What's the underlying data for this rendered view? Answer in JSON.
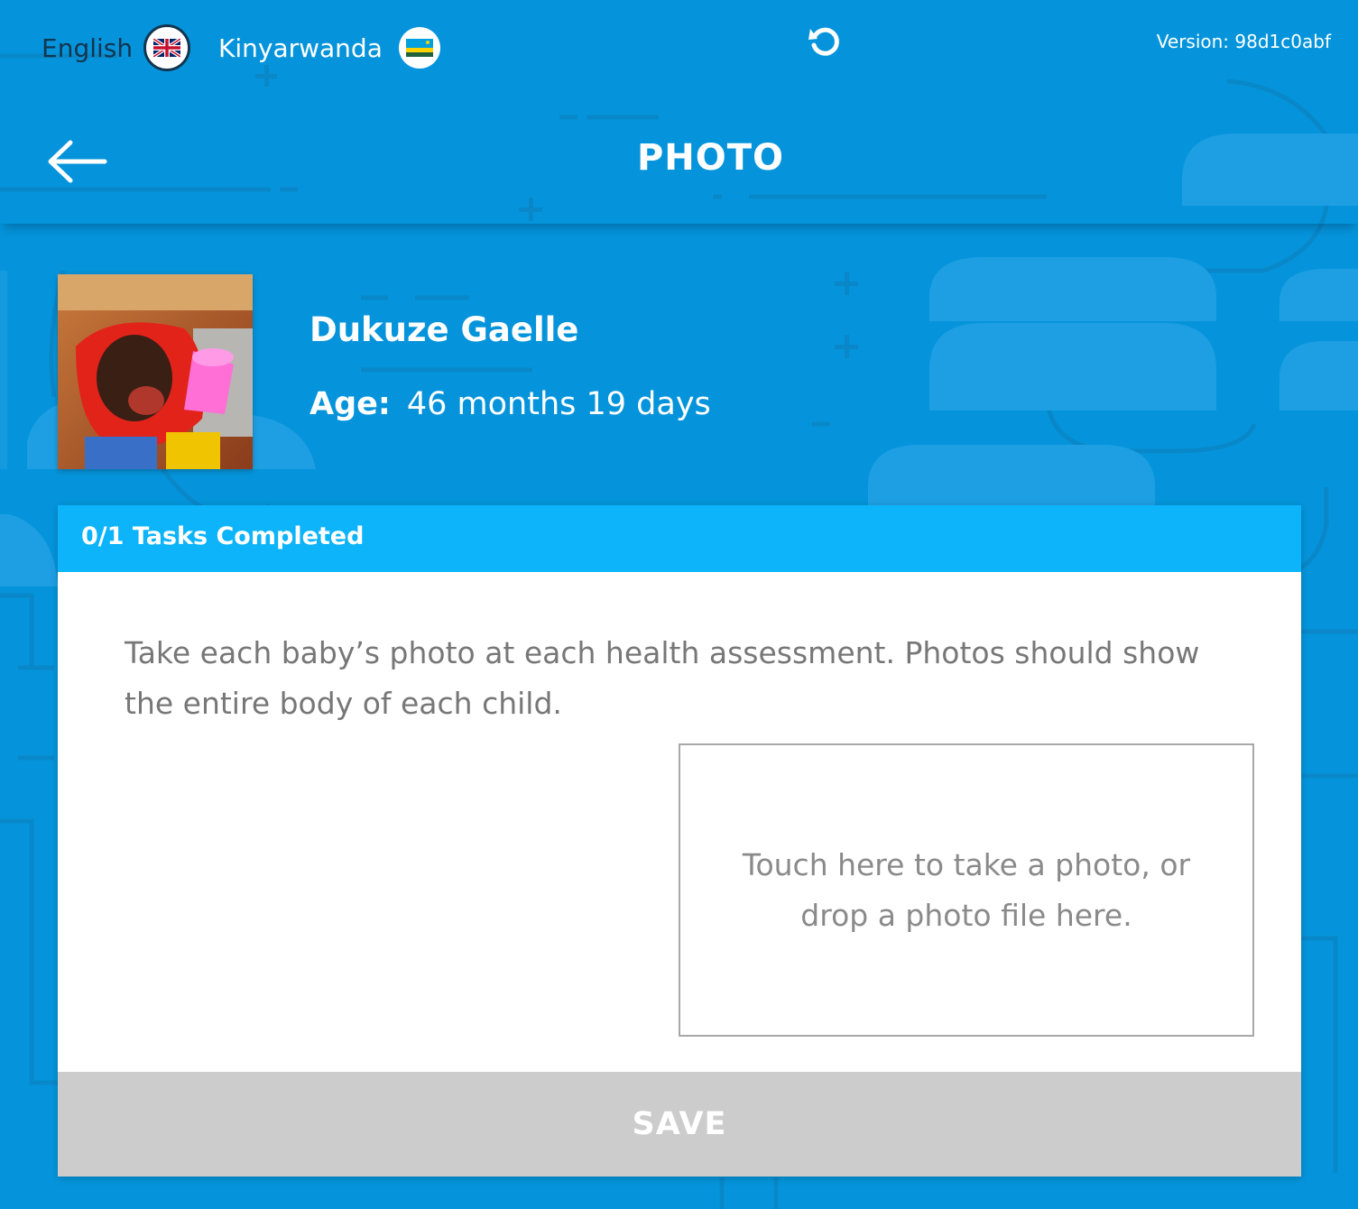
{
  "colors": {
    "background": "#0594db",
    "card_header": "#0db4f9",
    "save_disabled": "#cccccc",
    "text_dark": "#13354f"
  },
  "topbar": {
    "languages": [
      {
        "label": "English",
        "icon": "uk-flag-icon",
        "selected": true
      },
      {
        "label": "Kinyarwanda",
        "icon": "rwanda-flag-icon",
        "selected": false
      }
    ],
    "refresh_icon": "refresh-icon",
    "version": "Version: 98d1c0abf"
  },
  "header": {
    "back_icon": "back-arrow-icon",
    "title": "PHOTO"
  },
  "profile": {
    "name": "Dukuze Gaelle",
    "age_label": "Age:",
    "age_value": "46 months 19 days"
  },
  "card": {
    "tasks_status": "0/1 Tasks Completed",
    "instructions": "Take each baby’s photo at each health assessment. Photos should show the entire body of each child.",
    "dropzone_text": "Touch here to take a photo, or drop a photo file here.",
    "save_label": "SAVE"
  }
}
